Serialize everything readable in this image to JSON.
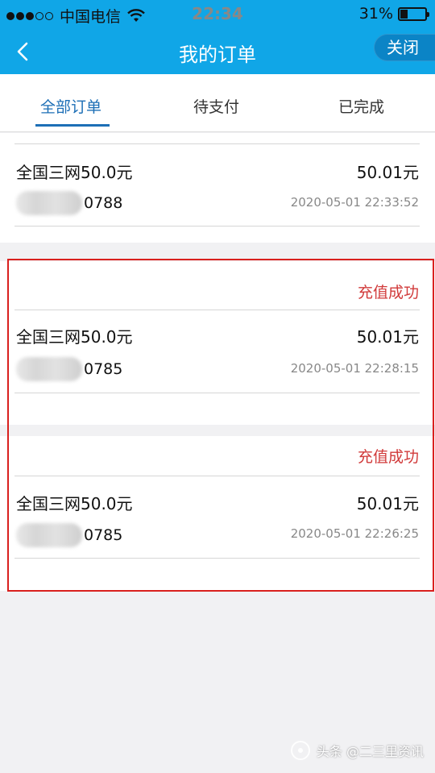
{
  "status_bar": {
    "carrier": "中国电信",
    "time": "22:34",
    "battery": "31%",
    "battery_level": 0.31
  },
  "navbar": {
    "title": "我的订单",
    "close_label": "关闭"
  },
  "tabs": [
    {
      "label": "全部订单",
      "active": true
    },
    {
      "label": "待支付",
      "active": false
    },
    {
      "label": "已完成",
      "active": false
    }
  ],
  "orders": [
    {
      "status": "",
      "product": "全国三网50.0元",
      "amount": "50.01元",
      "phone_suffix": "0788",
      "time": "2020-05-01 22:33:52"
    },
    {
      "status": "充值成功",
      "product": "全国三网50.0元",
      "amount": "50.01元",
      "phone_suffix": "0785",
      "time": "2020-05-01 22:28:15"
    },
    {
      "status": "充值成功",
      "product": "全国三网50.0元",
      "amount": "50.01元",
      "phone_suffix": "0785",
      "time": "2020-05-01 22:26:25"
    }
  ],
  "watermark": "头条 @二三里资讯",
  "colors": {
    "header": "#10a6e7",
    "tab_active": "#1d6fb6",
    "status_success": "#d13a3a",
    "highlight_border": "#d9201e"
  }
}
